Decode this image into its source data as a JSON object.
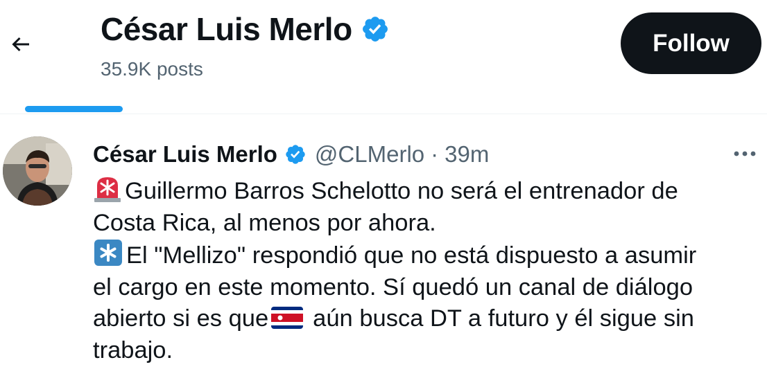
{
  "header": {
    "name": "César Luis Merlo",
    "posts": "35.9K posts",
    "follow_label": "Follow"
  },
  "tweet": {
    "name": "César Luis Merlo",
    "handle": "@CLMerlo",
    "separator": "·",
    "time": "39m",
    "lines": [
      "Guillermo Barros Schelotto no será el entrenador de",
      "Costa Rica, al menos por ahora.",
      "El \"Mellizo\" respondió que no está dispuesto a asumir",
      "el cargo en este momento. Sí quedó un canal de diálogo",
      "abierto si es que",
      "aún busca DT a futuro y él sigue sin",
      "trabajo."
    ]
  },
  "icons": [
    "back-arrow-icon",
    "verified-badge-icon",
    "more-options-icon",
    "siren-emoji-icon",
    "asterisk-emoji-icon",
    "costa-rica-flag-icon"
  ],
  "colors": {
    "accent": "#1d9bf0",
    "text": "#0f1419",
    "secondary": "#536471",
    "follow_bg": "#0f1419"
  }
}
